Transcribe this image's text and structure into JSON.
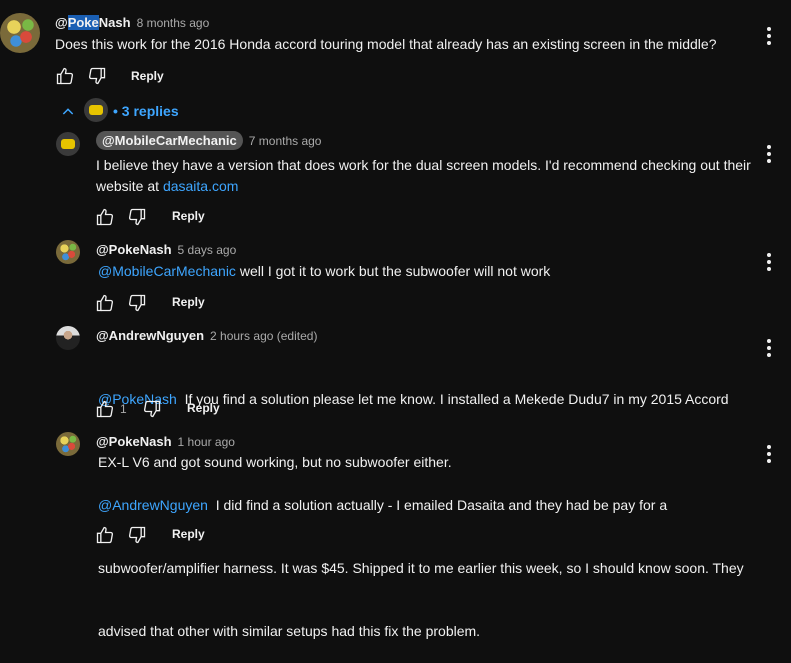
{
  "comments": [
    {
      "handle_hl": "Poke",
      "handle_rest": "Nash",
      "time": "8 months ago",
      "text": "Does this work for the 2016 Honda accord touring model that already has an existing screen in the middle?",
      "reply_label": "Reply",
      "avatar_icon": "pokemon-avatar"
    }
  ],
  "replies_toggle": {
    "label": "3 replies",
    "bullet": "•",
    "avatar_icon": "mobilecarmechanic-avatar"
  },
  "replies": [
    {
      "handle": "@MobileCarMechanic",
      "time": "7 months ago",
      "text_line1": "I believe they have a version that does work for the dual screen models. I'd recommend checking out their",
      "text_line2_prefix": "website at ",
      "link": "dasaita.com",
      "reply_label": "Reply"
    },
    {
      "handle": "@PokeNash",
      "time": "5 days ago",
      "mention": "@MobileCarMechanic",
      "text": " well I got it to work but the subwoofer will not work",
      "reply_label": "Reply"
    },
    {
      "handle": "@AndrewNguyen",
      "time": "2 hours ago (edited)",
      "mention": "@PokeNash",
      "text_line1": "  If you find a solution please let me know. I installed a Mekede Dudu7 in my 2015 Accord",
      "text_line2": "EX-L V6 and got sound working, but no subwoofer either.",
      "like_count": "1",
      "reply_label": "Reply"
    },
    {
      "handle": "@PokeNash",
      "time": "1 hour ago",
      "mention": "@AndrewNguyen",
      "text_line1": "  I did find a solution actually - I emailed Dasaita and they had be pay for a",
      "text_line2": "subwoofer/amplifier harness. It was $45. Shipped it to me earlier this week, so I should know soon. They",
      "text_line3": "advised that other with similar setups had this fix the problem.",
      "reply_label": "Reply"
    }
  ],
  "colors": {
    "background": "#0f0f0f",
    "link": "#3ea6ff",
    "text": "#f1f1f1",
    "muted": "#aaaaaa"
  }
}
